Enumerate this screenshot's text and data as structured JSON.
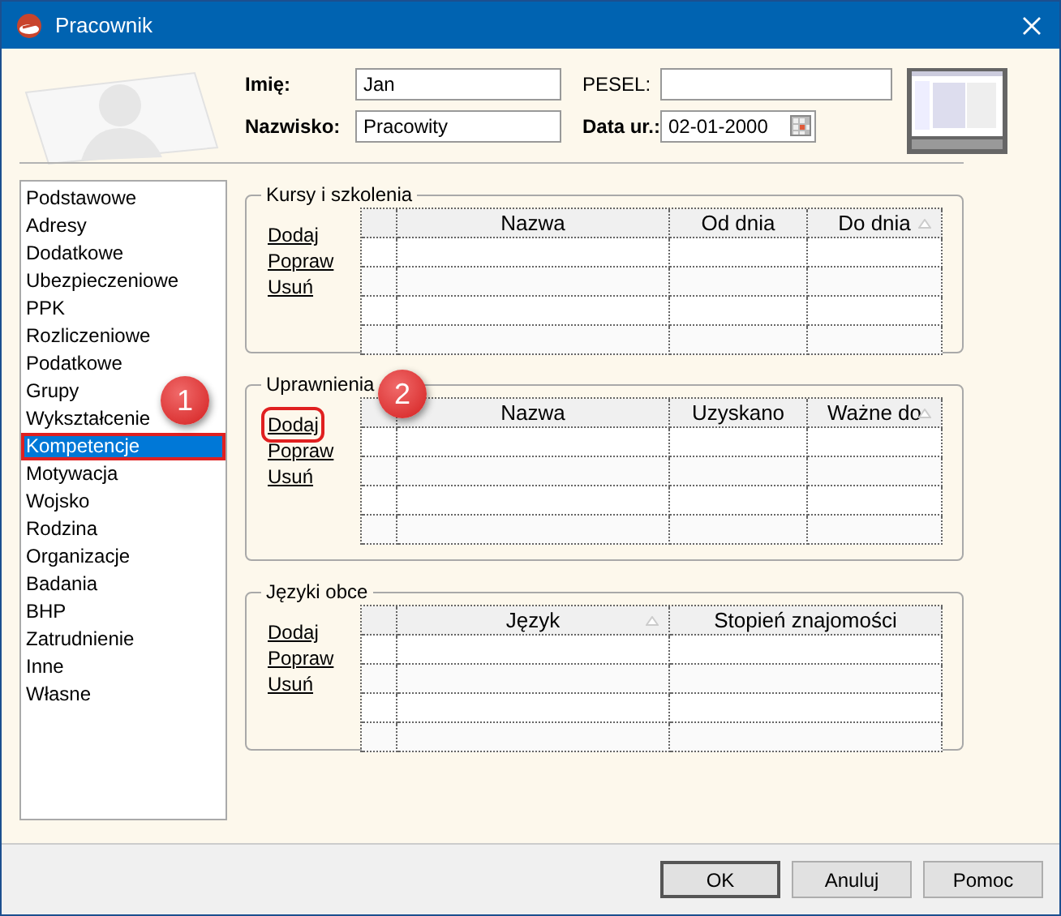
{
  "window": {
    "title": "Pracownik"
  },
  "header_fields": [
    {
      "label": "Imię:",
      "value": "Jan",
      "required": true,
      "kind": "text"
    },
    {
      "label": "PESEL:",
      "required": false,
      "kind": "text"
    },
    {
      "label": "Nazwisko:",
      "value": "Pracowity",
      "required": true,
      "kind": "text"
    },
    {
      "label": "Data ur.:",
      "value": "02-01-2000",
      "required": true,
      "kind": "date"
    }
  ],
  "sidebar": {
    "items": [
      {
        "label": "Podstawowe",
        "selected": false,
        "highlighted": false
      },
      {
        "label": "Adresy",
        "selected": false,
        "highlighted": false
      },
      {
        "label": "Dodatkowe",
        "selected": false,
        "highlighted": false
      },
      {
        "label": "Ubezpieczeniowe",
        "selected": false,
        "highlighted": false
      },
      {
        "label": "PPK",
        "selected": false,
        "highlighted": false
      },
      {
        "label": "Rozliczeniowe",
        "selected": false,
        "highlighted": false
      },
      {
        "label": "Podatkowe",
        "selected": false,
        "highlighted": false
      },
      {
        "label": "Grupy",
        "selected": false,
        "highlighted": false
      },
      {
        "label": "Wykształcenie",
        "selected": false,
        "highlighted": false
      },
      {
        "label": "Kompetencje",
        "selected": true,
        "highlighted": true
      },
      {
        "label": "Motywacja",
        "selected": false,
        "highlighted": false
      },
      {
        "label": "Wojsko",
        "selected": false,
        "highlighted": false
      },
      {
        "label": "Rodzina",
        "selected": false,
        "highlighted": false
      },
      {
        "label": "Organizacje",
        "selected": false,
        "highlighted": false
      },
      {
        "label": "Badania",
        "selected": false,
        "highlighted": false
      },
      {
        "label": "BHP",
        "selected": false,
        "highlighted": false
      },
      {
        "label": "Zatrudnienie",
        "selected": false,
        "highlighted": false
      },
      {
        "label": "Inne",
        "selected": false,
        "highlighted": false
      },
      {
        "label": "Własne",
        "selected": false,
        "highlighted": false
      }
    ]
  },
  "sections": [
    {
      "title": "Kursy i szkolenia",
      "actions": [
        {
          "label": "Dodaj",
          "highlighted": false
        },
        {
          "label": "Popraw",
          "highlighted": false
        },
        {
          "label": "Usuń",
          "highlighted": false
        }
      ],
      "columns": [
        {
          "label": "Nazwa",
          "sorted": false
        },
        {
          "label": "Od dnia",
          "sorted": false
        },
        {
          "label": "Do dnia",
          "sorted": true
        }
      ]
    },
    {
      "title": "Uprawnienia",
      "actions": [
        {
          "label": "Dodaj",
          "highlighted": true
        },
        {
          "label": "Popraw",
          "highlighted": false
        },
        {
          "label": "Usuń",
          "highlighted": false
        }
      ],
      "columns": [
        {
          "label": "Nazwa",
          "sorted": false
        },
        {
          "label": "Uzyskano",
          "sorted": false
        },
        {
          "label": "Ważne do",
          "sorted": true
        }
      ]
    },
    {
      "title": "Języki obce",
      "actions": [
        {
          "label": "Dodaj",
          "highlighted": false
        },
        {
          "label": "Popraw",
          "highlighted": false
        },
        {
          "label": "Usuń",
          "highlighted": false
        }
      ],
      "columns": [
        {
          "label": "Język",
          "sorted": true
        },
        {
          "label": "Stopień znajomości",
          "sorted": false
        }
      ]
    }
  ],
  "callouts": [
    {
      "number": "1"
    },
    {
      "number": "2"
    }
  ],
  "buttons": [
    {
      "label": "OK",
      "default": true
    },
    {
      "label": "Anuluj",
      "default": false
    },
    {
      "label": "Pomoc",
      "default": false
    }
  ]
}
